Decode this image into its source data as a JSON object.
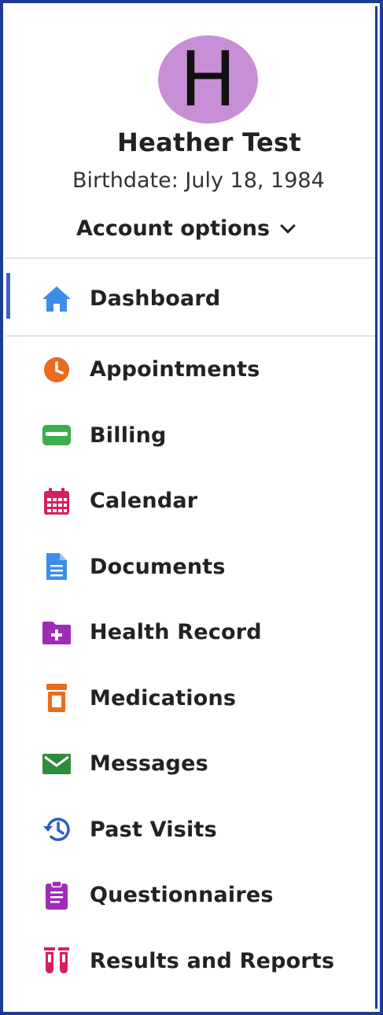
{
  "profile": {
    "avatar_initial": "H",
    "name": "Heather Test",
    "birthdate": "Birthdate: July 18, 1984",
    "account_options_label": "Account options"
  },
  "nav": {
    "items": [
      {
        "label": "Dashboard",
        "icon": "home-icon",
        "color": "#3d8de8",
        "active": true
      },
      {
        "label": "Appointments",
        "icon": "clock-icon",
        "color": "#ea6b1e"
      },
      {
        "label": "Billing",
        "icon": "wallet-icon",
        "color": "#3bae4d"
      },
      {
        "label": "Calendar",
        "icon": "calendar-icon",
        "color": "#d81f5e"
      },
      {
        "label": "Documents",
        "icon": "document-icon",
        "color": "#3d8de8"
      },
      {
        "label": "Health Record",
        "icon": "folder-plus-icon",
        "color": "#9e2db5"
      },
      {
        "label": "Medications",
        "icon": "pill-bottle-icon",
        "color": "#ea6b1e"
      },
      {
        "label": "Messages",
        "icon": "envelope-icon",
        "color": "#2e8d3a"
      },
      {
        "label": "Past Visits",
        "icon": "history-icon",
        "color": "#2d5fb8"
      },
      {
        "label": "Questionnaires",
        "icon": "clipboard-icon",
        "color": "#9e2db5"
      },
      {
        "label": "Results and Reports",
        "icon": "test-tubes-icon",
        "color": "#d81f5e"
      }
    ]
  },
  "colors": {
    "frame_border": "#1c3d8f",
    "avatar_bg": "#c98fd6",
    "active_indicator": "#3f5fc4"
  }
}
